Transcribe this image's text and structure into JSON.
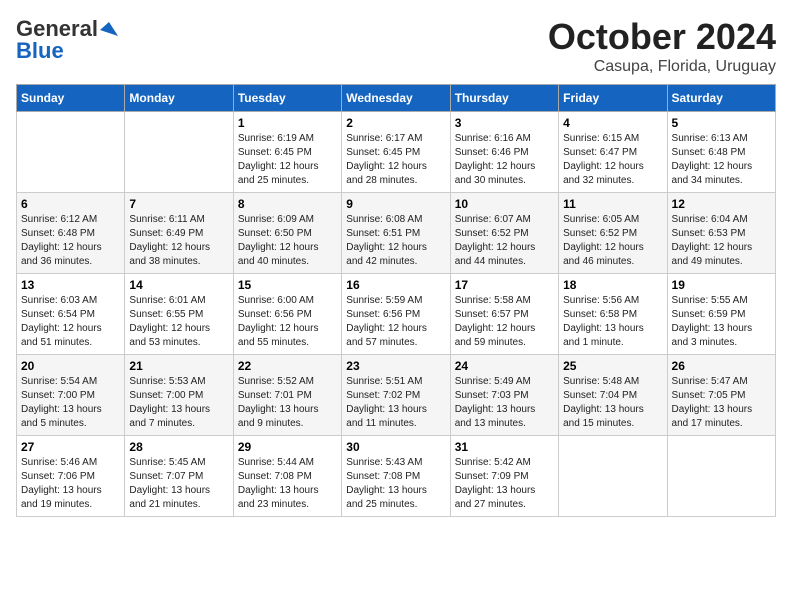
{
  "logo": {
    "general": "General",
    "blue": "Blue"
  },
  "title": "October 2024",
  "location": "Casupa, Florida, Uruguay",
  "days_of_week": [
    "Sunday",
    "Monday",
    "Tuesday",
    "Wednesday",
    "Thursday",
    "Friday",
    "Saturday"
  ],
  "weeks": [
    [
      {
        "day": "",
        "info": ""
      },
      {
        "day": "",
        "info": ""
      },
      {
        "day": "1",
        "info": "Sunrise: 6:19 AM\nSunset: 6:45 PM\nDaylight: 12 hours\nand 25 minutes."
      },
      {
        "day": "2",
        "info": "Sunrise: 6:17 AM\nSunset: 6:45 PM\nDaylight: 12 hours\nand 28 minutes."
      },
      {
        "day": "3",
        "info": "Sunrise: 6:16 AM\nSunset: 6:46 PM\nDaylight: 12 hours\nand 30 minutes."
      },
      {
        "day": "4",
        "info": "Sunrise: 6:15 AM\nSunset: 6:47 PM\nDaylight: 12 hours\nand 32 minutes."
      },
      {
        "day": "5",
        "info": "Sunrise: 6:13 AM\nSunset: 6:48 PM\nDaylight: 12 hours\nand 34 minutes."
      }
    ],
    [
      {
        "day": "6",
        "info": "Sunrise: 6:12 AM\nSunset: 6:48 PM\nDaylight: 12 hours\nand 36 minutes."
      },
      {
        "day": "7",
        "info": "Sunrise: 6:11 AM\nSunset: 6:49 PM\nDaylight: 12 hours\nand 38 minutes."
      },
      {
        "day": "8",
        "info": "Sunrise: 6:09 AM\nSunset: 6:50 PM\nDaylight: 12 hours\nand 40 minutes."
      },
      {
        "day": "9",
        "info": "Sunrise: 6:08 AM\nSunset: 6:51 PM\nDaylight: 12 hours\nand 42 minutes."
      },
      {
        "day": "10",
        "info": "Sunrise: 6:07 AM\nSunset: 6:52 PM\nDaylight: 12 hours\nand 44 minutes."
      },
      {
        "day": "11",
        "info": "Sunrise: 6:05 AM\nSunset: 6:52 PM\nDaylight: 12 hours\nand 46 minutes."
      },
      {
        "day": "12",
        "info": "Sunrise: 6:04 AM\nSunset: 6:53 PM\nDaylight: 12 hours\nand 49 minutes."
      }
    ],
    [
      {
        "day": "13",
        "info": "Sunrise: 6:03 AM\nSunset: 6:54 PM\nDaylight: 12 hours\nand 51 minutes."
      },
      {
        "day": "14",
        "info": "Sunrise: 6:01 AM\nSunset: 6:55 PM\nDaylight: 12 hours\nand 53 minutes."
      },
      {
        "day": "15",
        "info": "Sunrise: 6:00 AM\nSunset: 6:56 PM\nDaylight: 12 hours\nand 55 minutes."
      },
      {
        "day": "16",
        "info": "Sunrise: 5:59 AM\nSunset: 6:56 PM\nDaylight: 12 hours\nand 57 minutes."
      },
      {
        "day": "17",
        "info": "Sunrise: 5:58 AM\nSunset: 6:57 PM\nDaylight: 12 hours\nand 59 minutes."
      },
      {
        "day": "18",
        "info": "Sunrise: 5:56 AM\nSunset: 6:58 PM\nDaylight: 13 hours\nand 1 minute."
      },
      {
        "day": "19",
        "info": "Sunrise: 5:55 AM\nSunset: 6:59 PM\nDaylight: 13 hours\nand 3 minutes."
      }
    ],
    [
      {
        "day": "20",
        "info": "Sunrise: 5:54 AM\nSunset: 7:00 PM\nDaylight: 13 hours\nand 5 minutes."
      },
      {
        "day": "21",
        "info": "Sunrise: 5:53 AM\nSunset: 7:00 PM\nDaylight: 13 hours\nand 7 minutes."
      },
      {
        "day": "22",
        "info": "Sunrise: 5:52 AM\nSunset: 7:01 PM\nDaylight: 13 hours\nand 9 minutes."
      },
      {
        "day": "23",
        "info": "Sunrise: 5:51 AM\nSunset: 7:02 PM\nDaylight: 13 hours\nand 11 minutes."
      },
      {
        "day": "24",
        "info": "Sunrise: 5:49 AM\nSunset: 7:03 PM\nDaylight: 13 hours\nand 13 minutes."
      },
      {
        "day": "25",
        "info": "Sunrise: 5:48 AM\nSunset: 7:04 PM\nDaylight: 13 hours\nand 15 minutes."
      },
      {
        "day": "26",
        "info": "Sunrise: 5:47 AM\nSunset: 7:05 PM\nDaylight: 13 hours\nand 17 minutes."
      }
    ],
    [
      {
        "day": "27",
        "info": "Sunrise: 5:46 AM\nSunset: 7:06 PM\nDaylight: 13 hours\nand 19 minutes."
      },
      {
        "day": "28",
        "info": "Sunrise: 5:45 AM\nSunset: 7:07 PM\nDaylight: 13 hours\nand 21 minutes."
      },
      {
        "day": "29",
        "info": "Sunrise: 5:44 AM\nSunset: 7:08 PM\nDaylight: 13 hours\nand 23 minutes."
      },
      {
        "day": "30",
        "info": "Sunrise: 5:43 AM\nSunset: 7:08 PM\nDaylight: 13 hours\nand 25 minutes."
      },
      {
        "day": "31",
        "info": "Sunrise: 5:42 AM\nSunset: 7:09 PM\nDaylight: 13 hours\nand 27 minutes."
      },
      {
        "day": "",
        "info": ""
      },
      {
        "day": "",
        "info": ""
      }
    ]
  ]
}
